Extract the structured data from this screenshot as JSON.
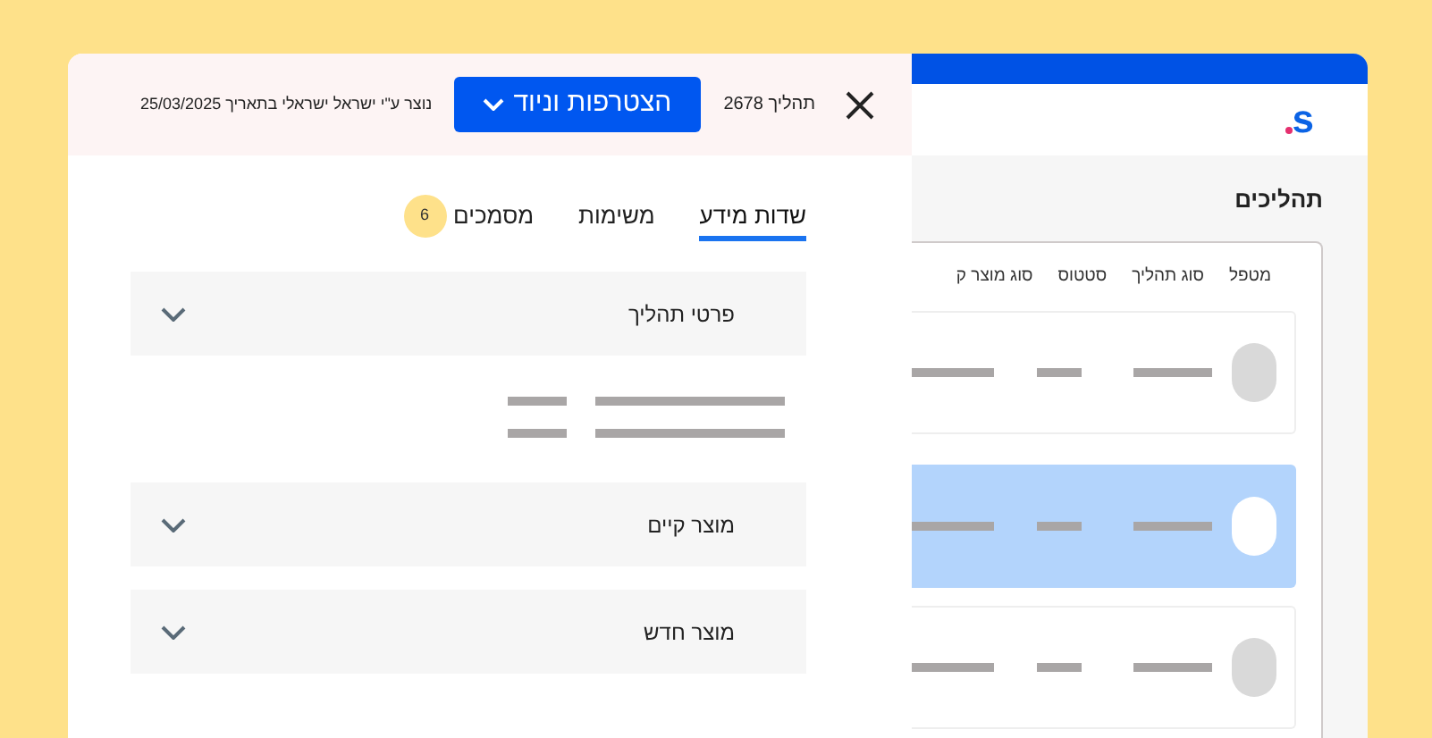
{
  "back_window": {
    "logo": "s",
    "title": "תהליכים",
    "columns": [
      "מטפל",
      "סוג תהליך",
      "סטטוס",
      "סוג מוצר ק"
    ],
    "rows": [
      {
        "selected": false
      },
      {
        "selected": true
      },
      {
        "selected": false
      }
    ]
  },
  "panel": {
    "process": "תהליך 2678",
    "action_button": "הצטרפות וניוד",
    "created": "נוצר ע\"י ישראל ישראלי בתאריך 25/03/2025",
    "tabs": [
      {
        "label": "שדות מידע",
        "selected": true
      },
      {
        "label": "משימות",
        "selected": false
      },
      {
        "label": "מסמכים",
        "selected": false,
        "badge": "6"
      }
    ],
    "sections": [
      {
        "title": "פרטי תהליך"
      },
      {
        "title": "מוצר קיים"
      },
      {
        "title": "מוצר חדש"
      }
    ]
  }
}
